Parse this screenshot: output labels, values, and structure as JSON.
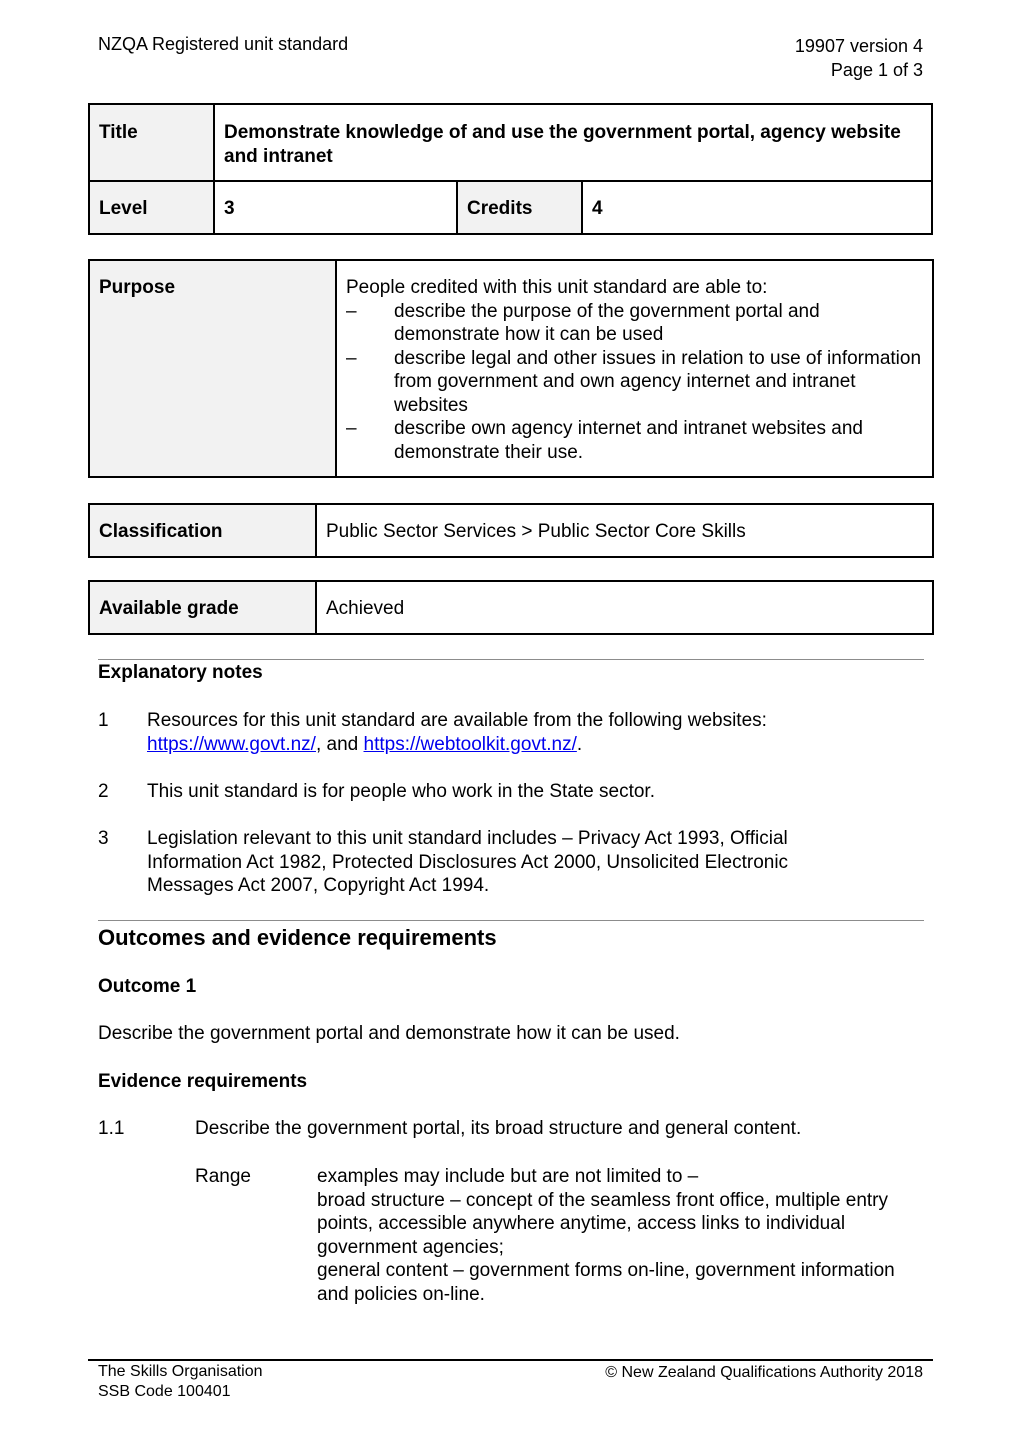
{
  "header": {
    "left": "NZQA Registered unit standard",
    "right_line1": "19907 version 4",
    "right_line2": "Page 1 of 3"
  },
  "summary": {
    "title_label": "Title",
    "title_value": "Demonstrate knowledge of and use the government portal, agency website and intranet",
    "level_label": "Level",
    "level_value": "3",
    "credits_label": "Credits",
    "credits_value": "4"
  },
  "purpose": {
    "label": "Purpose",
    "intro": "People credited with this unit standard are able to:",
    "dash": "–",
    "items": [
      "describe the purpose of the government portal and demonstrate how it can be used",
      "describe legal and other issues in relation to use of information from government and own agency internet and intranet websites",
      "describe own agency internet and intranet websites and demonstrate their use."
    ]
  },
  "classification": {
    "label": "Classification",
    "value": "Public Sector Services > Public Sector Core Skills"
  },
  "grade": {
    "label": "Available grade",
    "value": "Achieved"
  },
  "notes": {
    "heading": "Explanatory notes",
    "n1_num": "1",
    "n1_text": "Resources for this unit standard are available from the following websites:",
    "n1_link1": "https://www.govt.nz/",
    "n1_sep": ", and ",
    "n1_link2": "https://webtoolkit.govt.nz/",
    "n1_end": ".",
    "n2_num": "2",
    "n2_text": "This unit standard is for people who work in the State sector.",
    "n3_num": "3",
    "n3_text": "Legislation relevant to this unit standard includes – Privacy Act 1993, Official Information Act 1982, Protected Disclosures Act 2000, Unsolicited Electronic Messages Act 2007, Copyright Act 1994."
  },
  "outcomes": {
    "heading": "Outcomes and evidence requirements",
    "outcome1_heading": "Outcome 1",
    "outcome1_text": "Describe the government portal and demonstrate how it can be used.",
    "evidence_heading": "Evidence requirements",
    "ev_num": "1.1",
    "ev_text": "Describe the government portal, its broad structure and general content.",
    "range_label": "Range",
    "range_lines": [
      "examples may include but are not limited to –",
      "broad structure – concept of the seamless front office, multiple entry points, accessible anywhere anytime, access links to individual government agencies;",
      "general content – government forms on-line, government information and policies on-line."
    ]
  },
  "footer": {
    "org": "The Skills Organisation",
    "ssb": "SSB Code 100401",
    "copyright_symbol": "©",
    "copyright": "New Zealand Qualifications Authority 2018"
  }
}
